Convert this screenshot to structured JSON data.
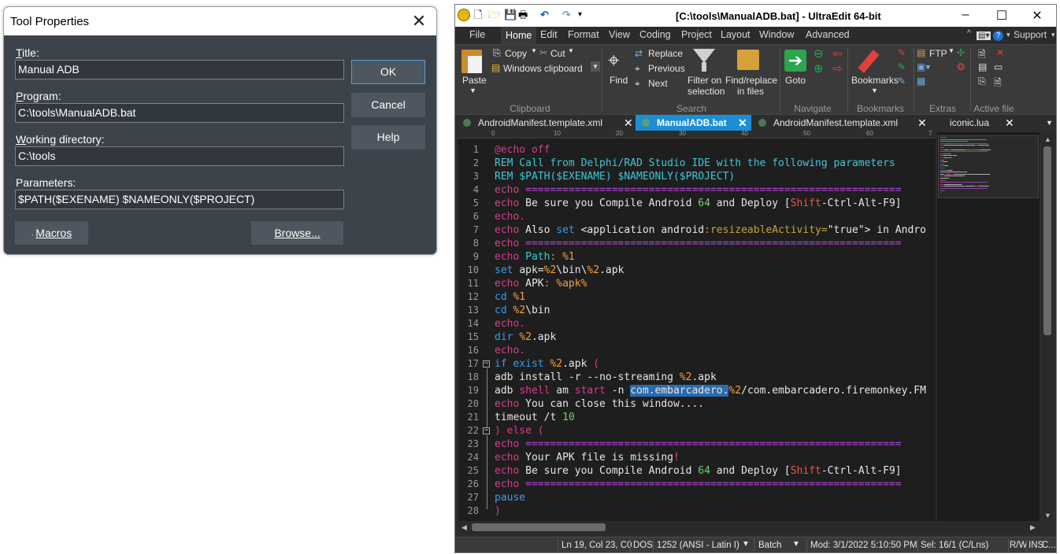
{
  "dialog": {
    "title": "Tool Properties",
    "fields": {
      "title": {
        "label_u": "T",
        "label_rest": "itle:",
        "value": "Manual ADB"
      },
      "program": {
        "label_u": "P",
        "label_rest": "rogram:",
        "value": "C:\\tools\\ManualADB.bat"
      },
      "workdir": {
        "label_u": "W",
        "label_rest": "orking directory:",
        "value": "C:\\tools"
      },
      "params": {
        "label_u": "",
        "label_rest": "Parameters:",
        "value": "$PATH($EXENAME) $NAMEONLY($PROJECT)"
      }
    },
    "buttons": {
      "ok": "OK",
      "cancel": "Cancel",
      "help": "Help",
      "macros": "Macros",
      "browse": "Browse..."
    }
  },
  "editor_app": {
    "window_title": "[C:\\tools\\ManualADB.bat] - UltraEdit 64-bit",
    "menu": [
      "File",
      "Home",
      "Edit",
      "Format",
      "View",
      "Coding",
      "Project",
      "Layout",
      "Window",
      "Advanced"
    ],
    "menu_active": "Home",
    "support": "Support",
    "ribbon": {
      "paste": "Paste",
      "copy": "Copy",
      "cut": "Cut",
      "windows_clipboard": "Windows clipboard",
      "find": "Find",
      "replace": "Replace",
      "previous": "Previous",
      "next": "Next",
      "filter_on_selection": [
        "Filter on",
        "selection"
      ],
      "find_replace_in_files": [
        "Find/replace",
        "in files"
      ],
      "goto": "Goto",
      "bookmarks": "Bookmarks",
      "ftp": "FTP",
      "groups": [
        "Clipboard",
        "Search",
        "Navigate",
        "Bookmarks",
        "Extras",
        "Active file"
      ]
    },
    "tabs": [
      {
        "label": "AndroidManifest.template.xml",
        "active": false
      },
      {
        "label": "ManualADB.bat",
        "active": true
      },
      {
        "label": "AndroidManifest.template.xml",
        "active": false
      },
      {
        "label": "iconic.lua",
        "active": false
      }
    ],
    "ruler_marks": [
      "0",
      "10",
      "20",
      "30",
      "40",
      "50",
      "60",
      "7"
    ],
    "code_lines": [
      [
        [
          "@echo off",
          "#d43f8d"
        ]
      ],
      [
        [
          "REM Call from Delphi/RAD Studio IDE with the following parameters",
          "#3fc7d9"
        ]
      ],
      [
        [
          "REM $PATH($EXENAME) $NAMEONLY($PROJECT)",
          "#3fc7d9"
        ]
      ],
      [
        [
          "echo ",
          "#d43f8d"
        ],
        [
          "=============================================================",
          "#b24ad6"
        ]
      ],
      [
        [
          "echo ",
          "#d43f8d"
        ],
        [
          "Be sure you Compile Android ",
          "#e6e6e6"
        ],
        [
          "64",
          "#6fd36f"
        ],
        [
          " and Deploy [",
          "#e6e6e6"
        ],
        [
          "Shift",
          "#f0584b"
        ],
        [
          "-",
          "#e6e6e6"
        ],
        [
          "Ctrl",
          "#e6e6e6"
        ],
        [
          "-",
          "#e6e6e6"
        ],
        [
          "Alt",
          "#e6e6e6"
        ],
        [
          "-",
          "#e6e6e6"
        ],
        [
          "F9]",
          "#e6e6e6"
        ]
      ],
      [
        [
          "echo.",
          "#d43f8d"
        ]
      ],
      [
        [
          "echo ",
          "#d43f8d"
        ],
        [
          "Also ",
          "#e6e6e6"
        ],
        [
          "set ",
          "#3a9bec"
        ],
        [
          "<application android",
          "#e6e6e6"
        ],
        [
          ":resizeableActivity=",
          "#c7a23a"
        ],
        [
          "\"true\"",
          "#e6e6e6"
        ],
        [
          "> in Andro",
          "#e6e6e6"
        ]
      ],
      [
        [
          "echo ",
          "#d43f8d"
        ],
        [
          "=============================================================",
          "#b24ad6"
        ]
      ],
      [
        [
          "echo ",
          "#d43f8d"
        ],
        [
          "Path",
          "#3fc7d9"
        ],
        [
          ": ",
          "#c7a23a"
        ],
        [
          "%1",
          "#f3a13a"
        ]
      ],
      [
        [
          "set ",
          "#3a9bec"
        ],
        [
          "apk=",
          "#e6e6e6"
        ],
        [
          "%2",
          "#f3a13a"
        ],
        [
          "\\bin\\",
          "#e6e6e6"
        ],
        [
          "%2",
          "#f3a13a"
        ],
        [
          ".apk",
          "#e6e6e6"
        ]
      ],
      [
        [
          "echo ",
          "#d43f8d"
        ],
        [
          "APK",
          "#e6e6e6"
        ],
        [
          ": ",
          "#c7a23a"
        ],
        [
          "%apk%",
          "#f3a13a"
        ]
      ],
      [
        [
          "cd ",
          "#3a9bec"
        ],
        [
          "%1",
          "#f3a13a"
        ]
      ],
      [
        [
          "cd ",
          "#3a9bec"
        ],
        [
          "%2",
          "#f3a13a"
        ],
        [
          "\\bin",
          "#e6e6e6"
        ]
      ],
      [
        [
          "echo.",
          "#d43f8d"
        ]
      ],
      [
        [
          "dir ",
          "#3a9bec"
        ],
        [
          "%2",
          "#f3a13a"
        ],
        [
          ".apk",
          "#e6e6e6"
        ]
      ],
      [
        [
          "echo.",
          "#d43f8d"
        ]
      ],
      [
        [
          "if exist ",
          "#3a9bec"
        ],
        [
          "%2",
          "#f3a13a"
        ],
        [
          ".apk ",
          "#e6e6e6"
        ],
        [
          "(",
          "#d43f8d"
        ]
      ],
      [
        [
          "adb install ",
          "#e6e6e6"
        ],
        [
          "-",
          "#e6e6e6"
        ],
        [
          "r ",
          "#e6e6e6"
        ],
        [
          "--",
          "#e6e6e6"
        ],
        [
          "no",
          "#e6e6e6"
        ],
        [
          "-",
          "#e6e6e6"
        ],
        [
          "streaming ",
          "#e6e6e6"
        ],
        [
          "%2",
          "#f3a13a"
        ],
        [
          ".apk",
          "#e6e6e6"
        ]
      ],
      [
        [
          "adb ",
          "#e6e6e6"
        ],
        [
          "shell ",
          "#d43f8d"
        ],
        [
          "am ",
          "#e6e6e6"
        ],
        [
          "start ",
          "#d43f8d"
        ],
        [
          "-",
          "#e6e6e6"
        ],
        [
          "n ",
          "#e6e6e6"
        ],
        [
          "com.embarcadero.",
          "#e6e6e6",
          "sel"
        ],
        [
          "%2",
          "#f3a13a"
        ],
        [
          "/",
          "#e6e6e6"
        ],
        [
          "com.embarcadero.firemonkey.FM",
          "#e6e6e6"
        ]
      ],
      [
        [
          "echo ",
          "#d43f8d"
        ],
        [
          "You can close this window....",
          "#e6e6e6"
        ]
      ],
      [
        [
          "timeout ",
          "#e6e6e6"
        ],
        [
          "/t ",
          "#e6e6e6"
        ],
        [
          "10",
          "#6fd36f"
        ]
      ],
      [
        [
          ") else (",
          "#d43f8d"
        ]
      ],
      [
        [
          "echo ",
          "#d43f8d"
        ],
        [
          "=============================================================",
          "#b24ad6"
        ]
      ],
      [
        [
          "echo ",
          "#d43f8d"
        ],
        [
          "Your APK file is missing",
          "#e6e6e6"
        ],
        [
          "!",
          "#f0584b"
        ]
      ],
      [
        [
          "echo ",
          "#d43f8d"
        ],
        [
          "Be sure you Compile Android ",
          "#e6e6e6"
        ],
        [
          "64",
          "#6fd36f"
        ],
        [
          " and Deploy [",
          "#e6e6e6"
        ],
        [
          "Shift",
          "#f0584b"
        ],
        [
          "-",
          "#e6e6e6"
        ],
        [
          "Ctrl",
          "#e6e6e6"
        ],
        [
          "-",
          "#e6e6e6"
        ],
        [
          "Alt",
          "#e6e6e6"
        ],
        [
          "-",
          "#e6e6e6"
        ],
        [
          "F9]",
          "#e6e6e6"
        ]
      ],
      [
        [
          "echo ",
          "#d43f8d"
        ],
        [
          "=============================================================",
          "#b24ad6"
        ]
      ],
      [
        [
          "pause",
          "#3a9bec"
        ]
      ],
      [
        [
          ")",
          "#d43f8d"
        ]
      ]
    ],
    "status": {
      "position": "Ln 19, Col 23, C0",
      "line_ending": "DOS",
      "encoding": "1252  (ANSI - Latin I)",
      "syntax": "Batch",
      "modified": "Mod: 3/1/2022 5:10:50 PM",
      "selection": "Sel: 16/1 (C/Lns)",
      "rw": "R/W",
      "ins": "INS",
      "col": "C..."
    }
  }
}
